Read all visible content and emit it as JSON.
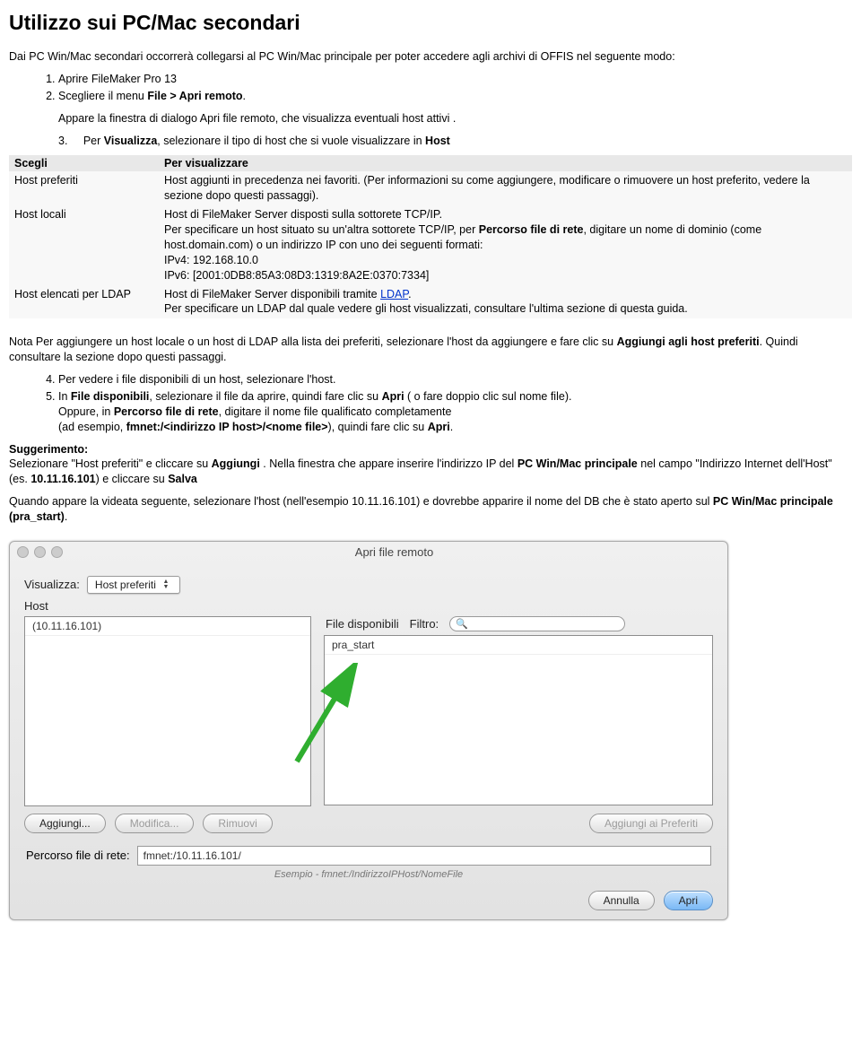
{
  "title": "Utilizzo sui PC/Mac secondari",
  "intro": "Dai PC Win/Mac secondari occorrerà collegarsi al PC Win/Mac principale per poter accedere agli archivi di OFFIS nel seguente modo:",
  "steps12": {
    "s1": "Aprire FileMaker Pro 13",
    "s2_a": "Scegliere il menu ",
    "s2_b": "File > Apri remoto",
    "s2_c": "."
  },
  "sub1": "Appare la finestra di dialogo Apri file remoto, che visualizza eventuali host attivi .",
  "step3": {
    "n": "3.",
    "a": "Per ",
    "b": "Visualizza",
    "c": ", selezionare il tipo di host che si vuole visualizzare in ",
    "d": "Host"
  },
  "table": {
    "h1": "Scegli",
    "h2": "Per visualizzare",
    "r1c1": "Host preferiti",
    "r1c2": "Host aggiunti in precedenza nei favoriti. (Per informazioni su come aggiungere, modificare o rimuovere un host preferito, vedere la sezione dopo questi passaggi).",
    "r2c1": "Host locali",
    "r2c2a": "Host di FileMaker Server disposti sulla sottorete TCP/IP.",
    "r2c2b_a": "Per specificare un host situato su un'altra sottorete TCP/IP, per ",
    "r2c2b_b": "Percorso file di rete",
    "r2c2b_c": ", digitare un nome di dominio (come host.domain.com) o un indirizzo IP con uno dei seguenti formati:",
    "r2c2c": "IPv4: 192.168.10.0",
    "r2c2d": "IPv6: [2001:0DB8:85A3:08D3:1319:8A2E:0370:7334]",
    "r3c1": "Host elencati per LDAP",
    "r3c2a_a": "Host di FileMaker Server disponibili tramite ",
    "r3c2a_b": "LDAP",
    "r3c2a_c": ".",
    "r3c2b": "Per specificare un LDAP dal quale vedere gli host visualizzati, consultare l'ultima sezione di questa guida."
  },
  "note": {
    "a": "Nota ",
    "b": " Per aggiungere un host locale o un host di LDAP alla lista dei preferiti, selezionare l'host da aggiungere e fare clic su ",
    "c": "Aggiungi agli host preferiti",
    "d": ". Quindi consultare la sezione dopo questi passaggi."
  },
  "steps45": {
    "s4": "Per vedere i file disponibili di un host, selezionare l'host.",
    "s5_a": "In ",
    "s5_b": "File disponibili",
    "s5_c": ", selezionare il file da aprire, quindi fare clic su ",
    "s5_d": "Apri",
    "s5_e": " ( o fare doppio clic sul nome file).",
    "s5_f": "Oppure, in ",
    "s5_g": "Percorso file di rete",
    "s5_h": ", digitare il nome file qualificato completamente",
    "s5_i": "(ad esempio, ",
    "s5_j": "fmnet:/<indirizzo IP host>/<nome file>",
    "s5_k": "), quindi fare clic su ",
    "s5_l": "Apri",
    "s5_m": "."
  },
  "sugg": {
    "h": "Suggerimento:",
    "a": "Selezionare \"Host preferiti\" e cliccare su ",
    "b": "Aggiungi ",
    "c": ". Nella finestra che appare inserire l'indirizzo IP del ",
    "d": "PC Win/Mac principale",
    "e": " nel campo \"Indirizzo Internet dell'Host\"",
    "f_a": "(es. ",
    "f_b": "10.11.16.101",
    "f_c": ") e cliccare su ",
    "f_d": "Salva"
  },
  "after": {
    "a": "Quando appare la videata seguente, selezionare l'host (nell'esempio 10.11.16.101) e dovrebbe apparire il nome del DB che è stato aperto sul ",
    "b": "PC Win/Mac principale (pra_start)",
    "c": "."
  },
  "dialog": {
    "title": "Apri file remoto",
    "visLabel": "Visualizza:",
    "visValue": "Host preferiti",
    "hostLabel": "Host",
    "hostItem": "(10.11.16.101)",
    "fileLabel": "File disponibili",
    "filterLabel": "Filtro:",
    "fileItem": "pra_start",
    "btnAdd": "Aggiungi...",
    "btnMod": "Modifica...",
    "btnRem": "Rimuovi",
    "btnFav": "Aggiungi ai Preferiti",
    "pathLabel": "Percorso file di rete:",
    "pathValue": "fmnet:/10.11.16.101/",
    "hint": "Esempio - fmnet:/IndirizzoIPHost/NomeFile",
    "btnCancel": "Annulla",
    "btnOpen": "Apri"
  }
}
